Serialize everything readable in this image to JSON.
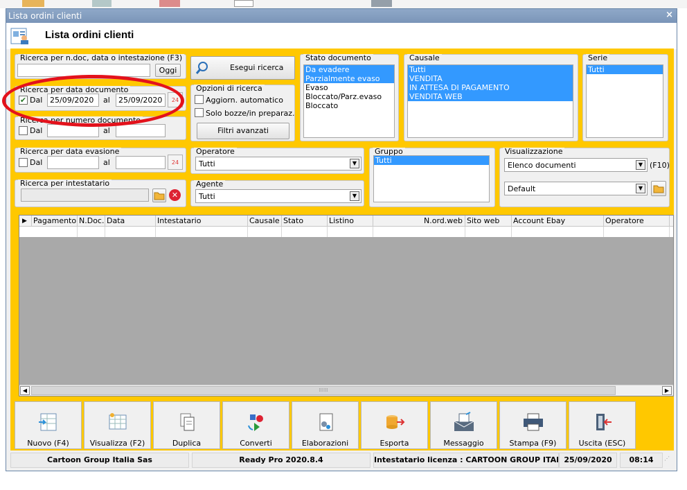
{
  "window": {
    "title": "Lista ordini clienti",
    "header_title": "Lista ordini clienti"
  },
  "search_text": {
    "caption": "Ricerca per n.doc, data o intestazione (F3)",
    "value": "",
    "today_button": "Oggi"
  },
  "search_by_doc_date": {
    "caption": "Ricerca per data documento",
    "from_checked": true,
    "from_label": "Dal",
    "from_value": "25/09/2020",
    "to_label": "al",
    "to_value": "25/09/2020"
  },
  "search_by_doc_number": {
    "caption": "Ricerca per numero documento",
    "from_label": "Dal",
    "to_label": "al"
  },
  "search_by_evasion_date": {
    "caption": "Ricerca per data evasione",
    "from_label": "Dal",
    "from_value": "",
    "to_label": "al",
    "to_value": ""
  },
  "search_by_holder": {
    "caption": "Ricerca per intestatario",
    "value": ""
  },
  "run_search": {
    "label": "Esegui ricerca"
  },
  "search_options": {
    "caption": "Opzioni di ricerca",
    "auto_refresh_label": "Aggiorn. automatico",
    "drafts_label": "Solo bozze/in preparaz.",
    "advanced_filters": "Filtri avanzati"
  },
  "doc_status": {
    "caption": "Stato documento",
    "items": [
      {
        "label": "Da evadere",
        "selected": true
      },
      {
        "label": "Parzialmente evaso",
        "selected": true
      },
      {
        "label": "Evaso",
        "selected": false
      },
      {
        "label": "Bloccato/Parz.evaso",
        "selected": false
      },
      {
        "label": "Bloccato",
        "selected": false
      }
    ]
  },
  "causale": {
    "caption": "Causale",
    "items": [
      {
        "label": "Tutti",
        "selected": true
      },
      {
        "label": "VENDITA",
        "selected": true
      },
      {
        "label": "IN ATTESA DI PAGAMENTO",
        "selected": true
      },
      {
        "label": "VENDITA WEB",
        "selected": true
      }
    ]
  },
  "serie": {
    "caption": "Serie",
    "items": [
      {
        "label": "Tutti",
        "selected": true
      }
    ]
  },
  "operatore": {
    "caption": "Operatore",
    "value": "Tutti"
  },
  "agente": {
    "caption": "Agente",
    "value": "Tutti"
  },
  "gruppo": {
    "caption": "Gruppo",
    "items": [
      {
        "label": "Tutti",
        "selected": true
      }
    ]
  },
  "visualizzazione": {
    "caption": "Visualizzazione",
    "mode_value": "Elenco documenti",
    "shortcut": "(F10)",
    "layout_value": "Default"
  },
  "grid": {
    "columns": [
      "Pagamento",
      "N.Doc.",
      "Data",
      "Intestatario",
      "Causale",
      "Stato",
      "Listino",
      "N.ord.web",
      "Sito web",
      "Account Ebay",
      "Operatore"
    ]
  },
  "toolbar": {
    "buttons": [
      {
        "label": "Nuovo (F4)",
        "icon": "new-document-icon"
      },
      {
        "label": "Visualizza (F2)",
        "icon": "view-grid-icon"
      },
      {
        "label": "Duplica",
        "icon": "duplicate-icon"
      },
      {
        "label": "Converti",
        "icon": "convert-icon"
      },
      {
        "label": "Elaborazioni",
        "icon": "processing-icon"
      },
      {
        "label": "Esporta",
        "icon": "export-icon"
      },
      {
        "label": "Messaggio",
        "icon": "message-icon"
      },
      {
        "label": "Stampa (F9)",
        "icon": "print-icon"
      },
      {
        "label": "Uscita (ESC)",
        "icon": "exit-icon"
      }
    ]
  },
  "status_bar": {
    "company": "Cartoon Group Italia Sas",
    "version": "Ready Pro 2020.8.4",
    "license": "Intestatario licenza : CARTOON GROUP ITALIA",
    "date": "25/09/2020",
    "time": "08:14"
  },
  "colors": {
    "accent_yellow": "#ffc800",
    "selection_blue": "#3399ff",
    "title_blue": "#7a95b8",
    "annotation_red": "#e3121c"
  }
}
